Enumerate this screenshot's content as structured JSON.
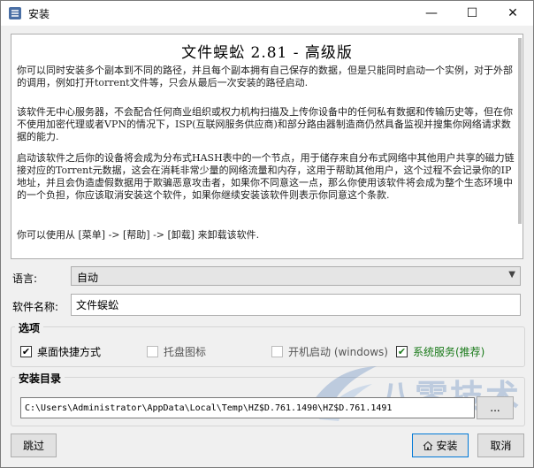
{
  "window": {
    "title": "安装"
  },
  "titlebar": {
    "min_glyph": "—",
    "max_glyph": "☐",
    "close_glyph": "✕"
  },
  "info": {
    "title": "文件蜈蚣  2.81 - 高级版",
    "p1": "你可以同时安装多个副本到不同的路径，并且每个副本拥有自己保存的数据，但是只能同时启动一个实例，对于外部的调用，例如打开torrent文件等，只会从最后一次安装的路径启动.",
    "p2": "该软件无中心服务器，不会配合任何商业组织或权力机构扫描及上传你设备中的任何私有数据和传输历史等，但在你不使用加密代理或者VPN的情况下，ISP(互联网服务供应商)和部分路由器制造商仍然具备监视并搜集你网络请求数据的能力.",
    "p3": "启动该软件之后你的设备将会成为分布式HASH表中的一个节点，用于储存来自分布式网络中其他用户共享的磁力链接对应的Torrent元数据，这会在消耗非常少量的网络流量和内存，这用于帮助其他用户，这个过程不会记录你的IP地址，并且会伪造虚假数据用于欺骗恶意攻击者，如果你不同意这一点，那么你使用该软件将会成为整个生态环境中的一个负担，你应该取消安装这个软件，如果你继续安装该软件则表示你同意这个条款.",
    "p4": "你可以使用从 [菜单] -> [帮助] -> [卸载] 来卸载该软件."
  },
  "form": {
    "language_label": "语言:",
    "language_value": "自动",
    "name_label": "软件名称:",
    "name_value": "文件蜈蚣"
  },
  "options": {
    "title": "选项",
    "items": [
      {
        "label": "桌面快捷方式",
        "checked": true
      },
      {
        "label": "托盘图标",
        "checked": false
      },
      {
        "label": "开机启动 (windows)",
        "checked": false
      },
      {
        "label": "系统服务(推荐)",
        "checked": true
      }
    ]
  },
  "install": {
    "title": "安装目录",
    "path": "C:\\Users\\Administrator\\AppData\\Local\\Temp\\HZ$D.761.1490\\HZ$D.761.1491",
    "browse_label": "..."
  },
  "buttons": {
    "skip": "跳过",
    "install": "安装",
    "cancel": "取消"
  },
  "watermark": {
    "text": "八零技术"
  },
  "colors": {
    "accent": "#0078d7",
    "recommended": "#1a7a1a",
    "watermark": "#3d6fb3"
  }
}
